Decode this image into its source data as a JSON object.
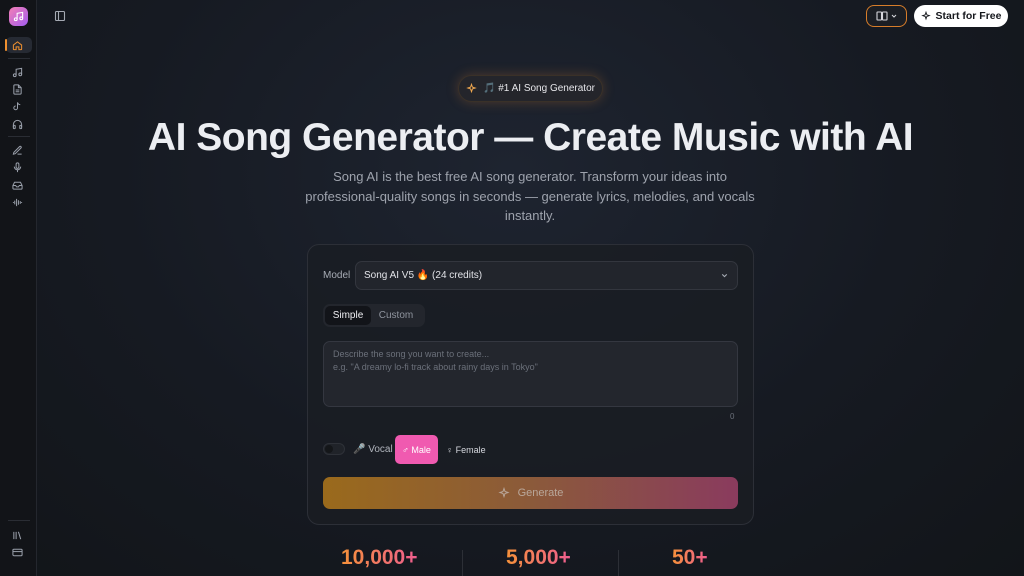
{
  "header": {
    "lang_icon": "book-open-icon",
    "cta_label": "Start for Free"
  },
  "sidebar": {
    "items": [
      "home-icon",
      "music-note-icon",
      "document-icon",
      "tiktok-icon",
      "headphones-icon",
      "pen-icon",
      "microphone-icon",
      "inbox-icon",
      "waveform-icon"
    ],
    "bottom": [
      "library-icon",
      "credit-card-icon"
    ]
  },
  "hero": {
    "badge": "🎵 #1 AI Song Generator",
    "title": "AI Song Generator — Create Music with AI",
    "subtitle": "Song AI is the best free AI song generator. Transform your ideas into professional-quality songs in seconds — generate lyrics, melodies, and vocals instantly."
  },
  "form": {
    "model_label": "Model",
    "model_value": "Song AI V5 🔥 (24 credits)",
    "tabs": {
      "simple": "Simple",
      "custom": "Custom"
    },
    "prompt_placeholder_line1": "Describe the song you want to create...",
    "prompt_placeholder_line2": "e.g. \"A dreamy lo-fi track about rainy days in Tokyo\"",
    "char_count": "0",
    "vocal_label": "🎤 Vocal",
    "male_label": "♂ Male",
    "female_label": "♀ Female",
    "generate_label": "Generate"
  },
  "stats": [
    "10,000+",
    "5,000+",
    "50+"
  ],
  "colors": {
    "accent_orange": "#f0902f",
    "accent_pink": "#f05ab0"
  }
}
